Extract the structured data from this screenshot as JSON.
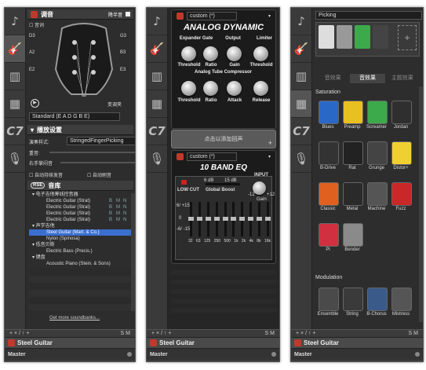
{
  "p1": {
    "header_title": "调音",
    "half_step": "降半音",
    "sound": "音词",
    "strings_left": [
      "D3",
      "A2",
      "E2"
    ],
    "strings_right": [
      "G3",
      "B3",
      "E3"
    ],
    "tuning_value": "Standard (E A D G B E)",
    "capo": "变调夹",
    "play_settings": "播放设置",
    "play_style_label": "演奏样式:",
    "play_style_value": "StringedFingerPicking",
    "accent": "重音:",
    "right_hand": "右手掌闷音",
    "auto_let_ring": "自动持续发音",
    "auto_brush": "自动刷音",
    "rse_label": "RSE",
    "sound_bank": "音库",
    "tree": [
      {
        "t": "电子吉他筹线控音器",
        "lvl": 0,
        "cat": true
      },
      {
        "t": "Electric Guitar (Strat)",
        "lvl": 1,
        "b": "B",
        "m": "M",
        "n": "N"
      },
      {
        "t": "Electric Guitar (Strat)",
        "lvl": 1,
        "b": "B",
        "m": "M",
        "n": "N"
      },
      {
        "t": "Electric Guitar (Strat)",
        "lvl": 1,
        "b": "B",
        "m": "M",
        "n": "N"
      },
      {
        "t": "Electric Guitar (Strat)",
        "lvl": 1,
        "b": "B",
        "m": "M",
        "n": "N"
      },
      {
        "t": "声学吉他",
        "lvl": 0,
        "cat": true
      },
      {
        "t": "Steel Guitar (Mart. & Co.)",
        "lvl": 1,
        "sel": true
      },
      {
        "t": "Nylon (Spinosa)",
        "lvl": 1
      },
      {
        "t": "低音贝斯",
        "lvl": 0,
        "cat": true
      },
      {
        "t": "Electric Bass (Precis.)",
        "lvl": 1
      },
      {
        "t": "键盘",
        "lvl": 0,
        "cat": true
      },
      {
        "t": "Acoustic Piano (Stein. & Sons)",
        "lvl": 1
      }
    ],
    "more_link": "Get more soundbanks..."
  },
  "p2": {
    "preset1": "custom (*)",
    "title1": "ANALOG DYNAMIC",
    "sec1": [
      "Expander Gate",
      "Output",
      "Limiter"
    ],
    "knobs1": [
      "Threshold",
      "Ratio",
      "Gain",
      "Threshold"
    ],
    "sec2": "Analog Tube Compressor",
    "knobs2": [
      "Threshold",
      "Ratio",
      "Attack",
      "Release"
    ],
    "add_return": "点击以添加回声",
    "plus": "+",
    "preset2": "custom (*)",
    "title2": "10 BAND EQ",
    "low_cut": "LOW CUT",
    "global_boost": "Global Boost",
    "input": "INPUT",
    "db_marks": [
      "6 dB",
      "15 dB"
    ],
    "gain_marks": [
      "6/ +15",
      "0",
      "-6/ -15"
    ],
    "input_marks": [
      "-12",
      "+12",
      "Gain"
    ],
    "freqs": [
      "32",
      "63",
      "125",
      "250",
      "500",
      "1k",
      "2k",
      "4k",
      "8k",
      "16k"
    ]
  },
  "p3": {
    "dropdown": "Picking",
    "tabs": [
      "音效果",
      "音效果",
      "主题效果"
    ],
    "saturation": "Saturation",
    "sat_rows": [
      [
        {
          "n": "Blues",
          "c": "#2a68c8"
        },
        {
          "n": "Preamp",
          "c": "#e8c020"
        },
        {
          "n": "Screamer",
          "c": "#3caa4a"
        },
        {
          "n": "Jordan",
          "c": "#2f2f2f"
        }
      ],
      [
        {
          "n": "B-Drive",
          "c": "#333333"
        },
        {
          "n": "Rat",
          "c": "#222222"
        },
        {
          "n": "Grunge",
          "c": "#444444"
        },
        {
          "n": "Distor+",
          "c": "#f0d030"
        }
      ],
      [
        {
          "n": "Classic",
          "c": "#e06020"
        },
        {
          "n": "Metal",
          "c": "#2a2a2a"
        },
        {
          "n": "Machine",
          "c": "#555555"
        },
        {
          "n": "Fuzz",
          "c": "#c82828"
        }
      ],
      [
        {
          "n": "Pi",
          "c": "#d03040"
        },
        {
          "n": "Bender",
          "c": "#8a8a8a"
        }
      ]
    ],
    "modulation": "Modulation",
    "mod_row": [
      {
        "n": "Ensemble",
        "c": "#4a4a4a"
      },
      {
        "n": "String",
        "c": "#3a3a3a"
      },
      {
        "n": "B-Chorus",
        "c": "#3a5a8a"
      },
      {
        "n": "Mistress",
        "c": "#555555"
      }
    ]
  },
  "bottom": {
    "toolbar": "+ × / ↑ +",
    "s": "S",
    "m": "M",
    "track": "Steel Guitar",
    "master": "Master"
  }
}
